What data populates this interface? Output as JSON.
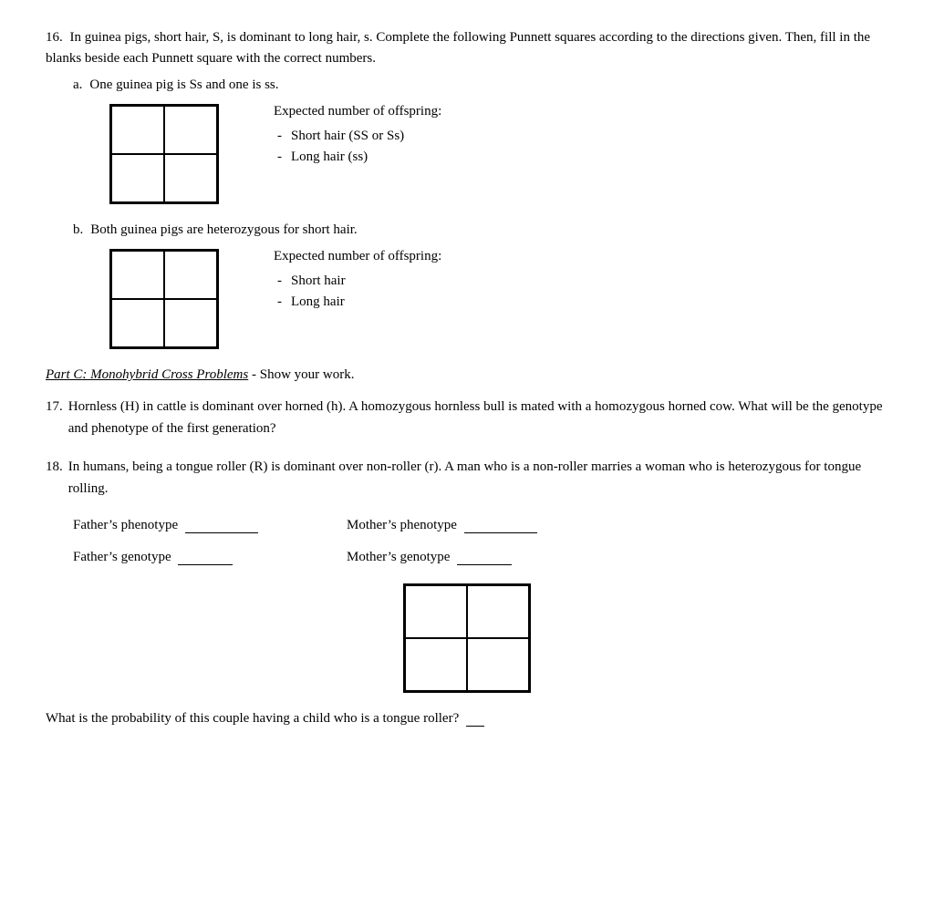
{
  "q16": {
    "number": "16.",
    "text": "In guinea pigs, short hair, S, is dominant to long hair, s.  Complete the following Punnett squares according to the directions given.  Then, fill in the blanks beside each Punnett square with the  correct numbers.",
    "a": {
      "label": "a.",
      "text": "One guinea pig is Ss  and one is ss.",
      "expected_title": "Expected number of offspring:",
      "row1_dash": "-",
      "row1_text": "Short hair  (SS or Ss)",
      "row2_dash": "-",
      "row2_text": "Long hair  (ss)"
    },
    "b": {
      "label": "b.",
      "text": "Both guinea pigs are heterozygous  for short hair.",
      "expected_title": "Expected number of offspring:",
      "row1_dash": "-",
      "row1_text": "Short hair",
      "row2_dash": "-",
      "row2_text": "Long hair"
    }
  },
  "partC": {
    "label": "Part C:  Monohybrid Cross Problems",
    "suffix": " -  Show your work."
  },
  "q17": {
    "number": "17.",
    "text": "Hornless (H) in cattle is dominant over horned (h).  A homozygous hornless bull is mated with  a homozygous horned cow.  What will be the genotype and phenotype of the first generation?"
  },
  "q18": {
    "number": "18.",
    "text": "In humans, being a tongue roller (R) is dominant over non-roller (r).  A man who is a non-roller  marries a woman who is heterozygous for tongue rolling.",
    "fathers_phenotype_label": "Father’s phenotype",
    "mothers_phenotype_label": "Mother’s phenotype",
    "fathers_genotype_label": "Father’s genotype",
    "mothers_genotype_label": "Mother’s genotype",
    "final_question": "What is the probability of this couple having a child who is a tongue roller?"
  }
}
